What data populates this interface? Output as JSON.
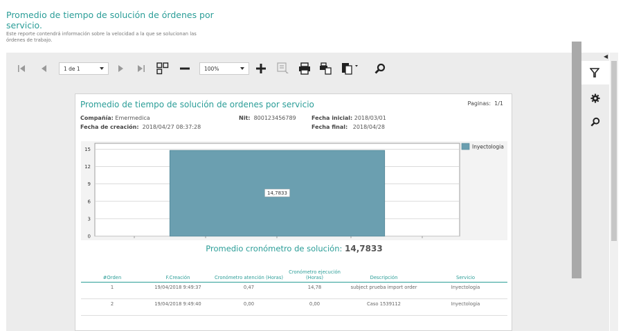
{
  "header": {
    "title": "Promedio de tiempo de solución de órdenes por servicio.",
    "description": "Este reporte contendrá información sobre la velocidad a la que se solucionan las órdenes de trabajo."
  },
  "toolbar": {
    "page_select": "1 de 1",
    "zoom_select": "100%",
    "icons": [
      "first-page-icon",
      "prev-page-icon",
      "next-page-icon",
      "last-page-icon",
      "multipage-icon",
      "zoom-out-icon",
      "zoom-in-icon",
      "highlight-icon",
      "print-icon",
      "print-page-icon",
      "export-icon",
      "search-icon"
    ]
  },
  "side_panel": {
    "icons": [
      "filter-icon",
      "gear-icon",
      "search-icon"
    ]
  },
  "report": {
    "title": "Promedio de tiempo de solución de ordenes por servicio",
    "pages_label": "Paginas:",
    "pages_value": "1/1",
    "company_label": "Compañía:",
    "company_value": "Emermedica",
    "nit_label": "Nit:",
    "nit_value": "800123456789",
    "start_label": "Fecha inicial:",
    "start_value": "2018/03/01",
    "created_label": "Fecha de creación:",
    "created_value": "2018/04/27 08:37:28",
    "end_label": "Fecha final:",
    "end_value": "2018/04/28",
    "summary_label": "Promedio cronómetro de solución:",
    "summary_value": "14,7833",
    "table": {
      "headers": [
        "#Orden",
        "F.Creación",
        "Cronómetro atención (Horas)",
        "Cronómetro ejecución (Horas)",
        "Descripción",
        "Servicio"
      ],
      "rows": [
        [
          "1",
          "19/04/2018 9:49:37",
          "0,47",
          "14,78",
          "subject prueba import order",
          "Inyectologia"
        ],
        [
          "2",
          "19/04/2018 9:49:40",
          "0,00",
          "0,00",
          "Caso 1539112",
          "Inyectologia"
        ]
      ]
    }
  },
  "chart_data": {
    "type": "bar",
    "categories": [
      ""
    ],
    "series": [
      {
        "name": "Inyectologia",
        "values": [
          14.7833
        ]
      }
    ],
    "data_labels": [
      "14,7833"
    ],
    "yticks": [
      "0",
      "3",
      "6",
      "9",
      "12",
      "15"
    ],
    "ylim": [
      0,
      16
    ],
    "grid": true,
    "legend": "right",
    "bar_color": "#6b9fb0"
  }
}
